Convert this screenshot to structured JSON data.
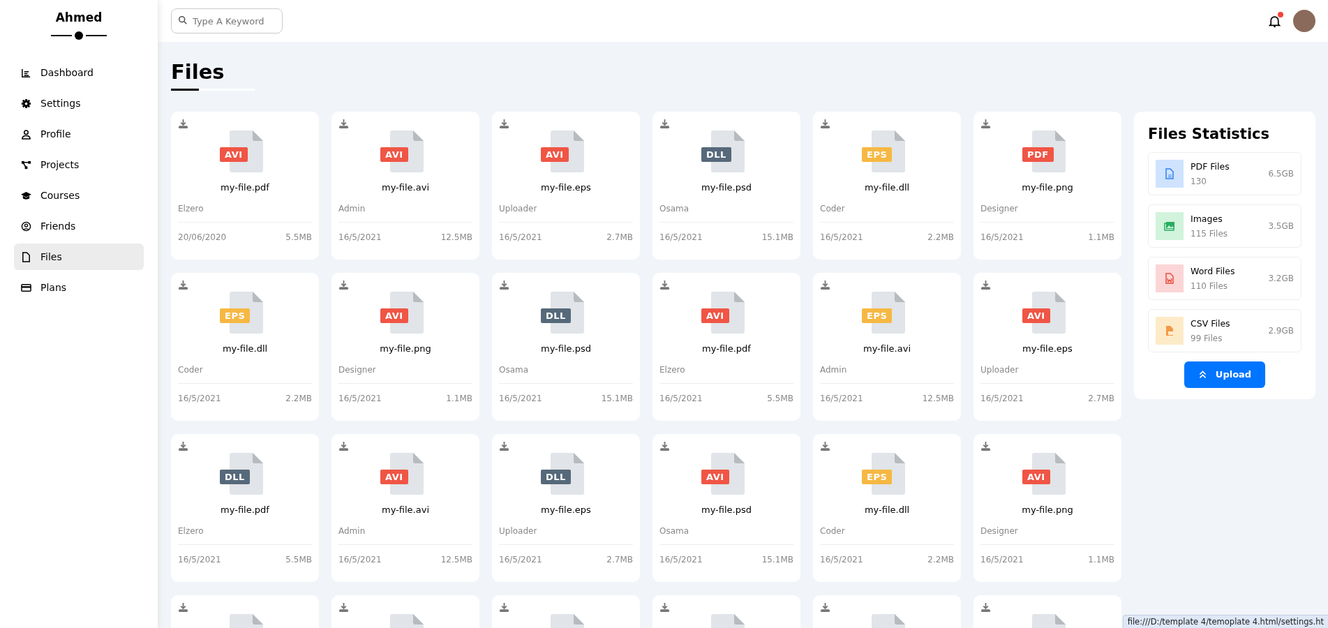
{
  "sidebar": {
    "title": "Ahmed",
    "items": [
      {
        "label": "Dashboard",
        "selected": false
      },
      {
        "label": "Settings",
        "selected": false
      },
      {
        "label": "Profile",
        "selected": false
      },
      {
        "label": "Projects",
        "selected": false
      },
      {
        "label": "Courses",
        "selected": false
      },
      {
        "label": "Friends",
        "selected": false
      },
      {
        "label": "Files",
        "selected": true
      },
      {
        "label": "Plans",
        "selected": false
      }
    ]
  },
  "topbar": {
    "search": {
      "placeholder": "Type A Keyword"
    },
    "notification": true
  },
  "page_title": "Files",
  "files": [
    {
      "kind": "file",
      "badge": "AVI",
      "color": "#f05545",
      "name": "my-file.pdf",
      "uploader": "Elzero",
      "date": "20/06/2020",
      "size": "5.5MB"
    },
    {
      "kind": "file",
      "badge": "AVI",
      "color": "#f05545",
      "name": "my-file.avi",
      "uploader": "Admin",
      "date": "16/5/2021",
      "size": "12.5MB"
    },
    {
      "kind": "file",
      "badge": "AVI",
      "color": "#f05545",
      "name": "my-file.eps",
      "uploader": "Uploader",
      "date": "16/5/2021",
      "size": "2.7MB"
    },
    {
      "kind": "file",
      "badge": "DLL",
      "color": "#56697a",
      "name": "my-file.psd",
      "uploader": "Osama",
      "date": "16/5/2021",
      "size": "15.1MB"
    },
    {
      "kind": "file",
      "badge": "EPS",
      "color": "#f6b843",
      "name": "my-file.dll",
      "uploader": "Coder",
      "date": "16/5/2021",
      "size": "2.2MB"
    },
    {
      "kind": "file",
      "badge": "PDF",
      "color": "#f05545",
      "name": "my-file.png",
      "uploader": "Designer",
      "date": "16/5/2021",
      "size": "1.1MB"
    },
    {
      "kind": "file",
      "badge": "EPS",
      "color": "#f6b843",
      "name": "my-file.dll",
      "uploader": "Coder",
      "date": "16/5/2021",
      "size": "2.2MB"
    },
    {
      "kind": "file",
      "badge": "AVI",
      "color": "#f05545",
      "name": "my-file.png",
      "uploader": "Designer",
      "date": "16/5/2021",
      "size": "1.1MB"
    },
    {
      "kind": "file",
      "badge": "DLL",
      "color": "#56697a",
      "name": "my-file.psd",
      "uploader": "Osama",
      "date": "16/5/2021",
      "size": "15.1MB"
    },
    {
      "kind": "file",
      "badge": "AVI",
      "color": "#f05545",
      "name": "my-file.pdf",
      "uploader": "Elzero",
      "date": "16/5/2021",
      "size": "5.5MB"
    },
    {
      "kind": "file",
      "badge": "EPS",
      "color": "#f6b843",
      "name": "my-file.avi",
      "uploader": "Admin",
      "date": "16/5/2021",
      "size": "12.5MB"
    },
    {
      "kind": "file",
      "badge": "AVI",
      "color": "#f05545",
      "name": "my-file.eps",
      "uploader": "Uploader",
      "date": "16/5/2021",
      "size": "2.7MB"
    },
    {
      "kind": "file",
      "badge": "DLL",
      "color": "#56697a",
      "name": "my-file.pdf",
      "uploader": "Elzero",
      "date": "16/5/2021",
      "size": "5.5MB"
    },
    {
      "kind": "file",
      "badge": "AVI",
      "color": "#f05545",
      "name": "my-file.avi",
      "uploader": "Admin",
      "date": "16/5/2021",
      "size": "12.5MB"
    },
    {
      "kind": "file",
      "badge": "DLL",
      "color": "#56697a",
      "name": "my-file.eps",
      "uploader": "Uploader",
      "date": "16/5/2021",
      "size": "2.7MB"
    },
    {
      "kind": "file",
      "badge": "AVI",
      "color": "#f05545",
      "name": "my-file.psd",
      "uploader": "Osama",
      "date": "16/5/2021",
      "size": "15.1MB"
    },
    {
      "kind": "file",
      "badge": "EPS",
      "color": "#f6b843",
      "name": "my-file.dll",
      "uploader": "Coder",
      "date": "16/5/2021",
      "size": "2.2MB"
    },
    {
      "kind": "file",
      "badge": "AVI",
      "color": "#f05545",
      "name": "my-file.png",
      "uploader": "Designer",
      "date": "16/5/2021",
      "size": "1.1MB"
    },
    {
      "kind": "cut"
    },
    {
      "kind": "cut"
    },
    {
      "kind": "cut"
    },
    {
      "kind": "cut"
    },
    {
      "kind": "cut"
    },
    {
      "kind": "cut"
    }
  ],
  "statistics": {
    "title": "Files Statistics",
    "items": [
      {
        "kind": "pdf",
        "label": "PDF Files",
        "count": "130",
        "size": "6.5GB"
      },
      {
        "kind": "image",
        "label": "Images",
        "count": "115 Files",
        "size": "3.5GB"
      },
      {
        "kind": "word",
        "label": "Word Files",
        "count": "110 Files",
        "size": "3.2GB"
      },
      {
        "kind": "csv",
        "label": "CSV Files",
        "count": "99 Files",
        "size": "2.9GB"
      }
    ],
    "button": "Upload"
  },
  "status_bar": "file:///D:/template 4/temoplate 4.html/settings.ht"
}
